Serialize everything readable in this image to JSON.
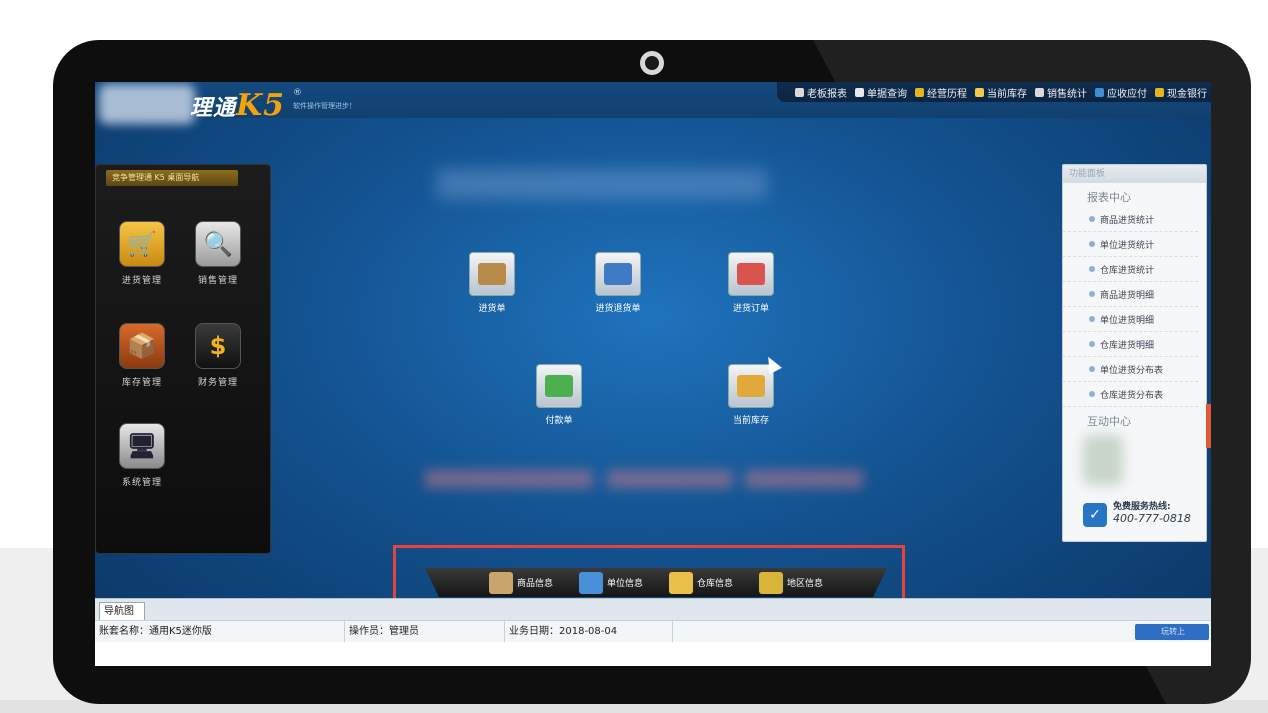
{
  "app": {
    "logo_main": "理通",
    "logo_version": "K5",
    "logo_mark": "®",
    "slogan": "软件操作管理进步！"
  },
  "top_menu": [
    {
      "label": "老板报表",
      "color": "#d9d9d9"
    },
    {
      "label": "单据查询",
      "color": "#e8e8e8"
    },
    {
      "label": "经营历程",
      "color": "#e6b422"
    },
    {
      "label": "当前库存",
      "color": "#f2c94c"
    },
    {
      "label": "销售统计",
      "color": "#d9d9d9"
    },
    {
      "label": "应收应付",
      "color": "#3d8fd6"
    },
    {
      "label": "现金银行",
      "color": "#e6b422"
    }
  ],
  "left_panel": {
    "title": "竞争管理通 K5 桌面导航",
    "items": [
      {
        "label": "进货管理",
        "glyph": "🛒"
      },
      {
        "label": "销售管理",
        "glyph": "🔍"
      },
      {
        "label": "库存管理",
        "glyph": "📦"
      },
      {
        "label": "财务管理",
        "glyph": "$"
      },
      {
        "label": "系统管理",
        "glyph": "🖥"
      }
    ]
  },
  "functions": [
    {
      "label": "进货单",
      "color": "#b88a4a"
    },
    {
      "label": "进货退货单",
      "color": "#3e7bc4"
    },
    {
      "label": "进货订单",
      "color": "#d9534f"
    },
    {
      "label": "付款单",
      "color": "#4caf50"
    },
    {
      "label": "当前库存",
      "color": "#e0a93a"
    }
  ],
  "right_panel": {
    "header": "功能面板",
    "report_title": "报表中心",
    "reports": [
      "商品进货统计",
      "单位进货统计",
      "仓库进货统计",
      "商品进货明细",
      "单位进货明细",
      "仓库进货明细",
      "单位进货分布表",
      "仓库进货分布表"
    ],
    "interact_title": "互动中心",
    "hotline_label": "免费服务热线:",
    "hotline_number": "400-777-0818"
  },
  "bottom_bar": [
    {
      "label": "商品信息",
      "color": "#c9a46b"
    },
    {
      "label": "单位信息",
      "color": "#4a90d9"
    },
    {
      "label": "仓库信息",
      "color": "#e8c04a"
    },
    {
      "label": "地区信息",
      "color": "#d8b43a"
    }
  ],
  "tab": {
    "label": "导航图"
  },
  "status": {
    "account": "账套名称：通用K5迷你版",
    "operator": "操作员：管理员",
    "date": "业务日期：2018-08-04",
    "logo_text": "玩转上"
  }
}
